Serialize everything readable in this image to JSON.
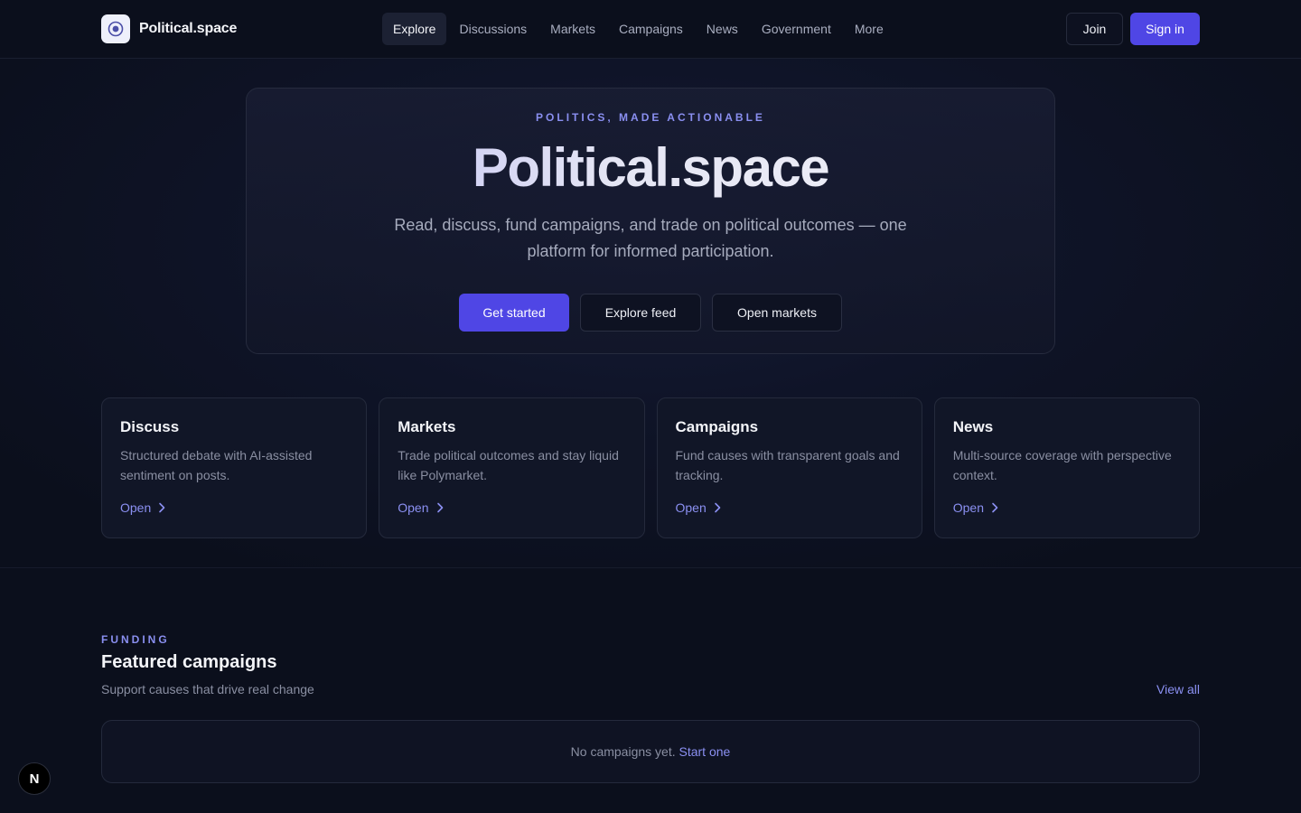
{
  "brand": {
    "name": "Political.space",
    "logo_icon": "target-icon"
  },
  "nav": {
    "items": [
      {
        "label": "Explore",
        "active": true
      },
      {
        "label": "Discussions"
      },
      {
        "label": "Markets"
      },
      {
        "label": "Campaigns"
      },
      {
        "label": "News"
      },
      {
        "label": "Government"
      },
      {
        "label": "More"
      }
    ]
  },
  "auth": {
    "join_label": "Join",
    "signin_label": "Sign in"
  },
  "hero": {
    "eyebrow": "POLITICS, MADE ACTIONABLE",
    "title": "Political.space",
    "subtitle": "Read, discuss, fund campaigns, and trade on political outcomes — one platform for informed participation.",
    "primary_label": "Get started",
    "secondary_label": "Explore feed",
    "tertiary_label": "Open markets"
  },
  "cards": [
    {
      "title": "Discuss",
      "desc": "Structured debate with AI-assisted sentiment on posts.",
      "link": "Open"
    },
    {
      "title": "Markets",
      "desc": "Trade political outcomes and stay liquid like Polymarket.",
      "link": "Open"
    },
    {
      "title": "Campaigns",
      "desc": "Fund causes with transparent goals and tracking.",
      "link": "Open"
    },
    {
      "title": "News",
      "desc": "Multi-source coverage with perspective context.",
      "link": "Open"
    }
  ],
  "featured": {
    "eyebrow": "FUNDING",
    "title": "Featured campaigns",
    "subtitle": "Support causes that drive real change",
    "view_all": "View all",
    "empty_text": "No campaigns yet.",
    "empty_link": "Start one"
  },
  "badge": {
    "letter": "N"
  },
  "colors": {
    "accent": "#4f46e5",
    "link": "#8b90f2",
    "background": "#0b0f1c"
  }
}
